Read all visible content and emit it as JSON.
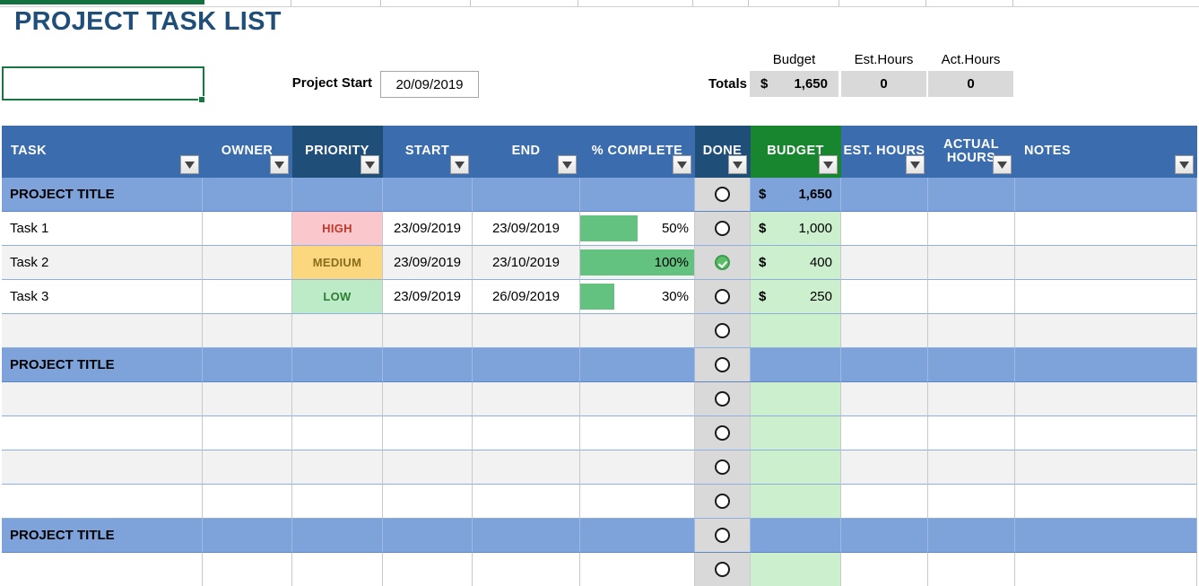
{
  "page": {
    "title": "PROJECT TASK LIST"
  },
  "project_start": {
    "label": "Project Start",
    "value": "20/09/2019"
  },
  "totals": {
    "label": "Totals",
    "headers": [
      "Budget",
      "Est.Hours",
      "Act.Hours"
    ],
    "budget_currency": "$",
    "budget_value": "1,650",
    "est_hours": "0",
    "act_hours": "0"
  },
  "table": {
    "columns": [
      {
        "label": "TASK",
        "align": "left",
        "filter": true,
        "style": "normal"
      },
      {
        "label": "OWNER",
        "align": "center",
        "filter": true,
        "style": "normal"
      },
      {
        "label": "PRIORITY",
        "align": "center",
        "filter": true,
        "style": "dark"
      },
      {
        "label": "START",
        "align": "center",
        "filter": true,
        "style": "normal"
      },
      {
        "label": "END",
        "align": "center",
        "filter": true,
        "style": "normal"
      },
      {
        "label": "% COMPLETE",
        "align": "center",
        "filter": true,
        "style": "normal"
      },
      {
        "label": "DONE",
        "align": "center",
        "filter": true,
        "style": "dark"
      },
      {
        "label": "BUDGET",
        "align": "center",
        "filter": true,
        "style": "green"
      },
      {
        "label": "EST. HOURS",
        "align": "center",
        "filter": true,
        "style": "normal"
      },
      {
        "label": "ACTUAL HOURS",
        "align": "center",
        "filter": true,
        "style": "normal"
      },
      {
        "label": "NOTES",
        "align": "left",
        "filter": true,
        "style": "normal"
      }
    ],
    "rows": [
      {
        "type": "section",
        "task": "PROJECT TITLE",
        "owner": "",
        "priority": "",
        "start": "",
        "end": "",
        "percent": null,
        "percent_label": "",
        "done": false,
        "budget_currency": "$",
        "budget": "1,650",
        "est_hours": "",
        "actual_hours": "",
        "notes": ""
      },
      {
        "type": "task",
        "task": "Task 1",
        "owner": "",
        "priority": "HIGH",
        "start": "23/09/2019",
        "end": "23/09/2019",
        "percent": 50,
        "percent_label": "50%",
        "done": false,
        "budget_currency": "$",
        "budget": "1,000",
        "est_hours": "",
        "actual_hours": "",
        "notes": ""
      },
      {
        "type": "task",
        "task": "Task 2",
        "owner": "",
        "priority": "MEDIUM",
        "start": "23/09/2019",
        "end": "23/10/2019",
        "percent": 100,
        "percent_label": "100%",
        "done": true,
        "budget_currency": "$",
        "budget": "400",
        "est_hours": "",
        "actual_hours": "",
        "notes": ""
      },
      {
        "type": "task",
        "task": "Task 3",
        "owner": "",
        "priority": "LOW",
        "start": "23/09/2019",
        "end": "26/09/2019",
        "percent": 30,
        "percent_label": "30%",
        "done": false,
        "budget_currency": "$",
        "budget": "250",
        "est_hours": "",
        "actual_hours": "",
        "notes": ""
      },
      {
        "type": "empty",
        "task": "",
        "owner": "",
        "priority": "",
        "start": "",
        "end": "",
        "percent": null,
        "percent_label": "",
        "done": false,
        "budget_currency": "",
        "budget": "",
        "est_hours": "",
        "actual_hours": "",
        "notes": ""
      },
      {
        "type": "section",
        "task": "PROJECT TITLE",
        "owner": "",
        "priority": "",
        "start": "",
        "end": "",
        "percent": null,
        "percent_label": "",
        "done": false,
        "budget_currency": "",
        "budget": "",
        "est_hours": "",
        "actual_hours": "",
        "notes": ""
      },
      {
        "type": "empty",
        "task": "",
        "owner": "",
        "priority": "",
        "start": "",
        "end": "",
        "percent": null,
        "percent_label": "",
        "done": false,
        "budget_currency": "",
        "budget": "",
        "est_hours": "",
        "actual_hours": "",
        "notes": ""
      },
      {
        "type": "empty",
        "task": "",
        "owner": "",
        "priority": "",
        "start": "",
        "end": "",
        "percent": null,
        "percent_label": "",
        "done": false,
        "budget_currency": "",
        "budget": "",
        "est_hours": "",
        "actual_hours": "",
        "notes": ""
      },
      {
        "type": "empty",
        "task": "",
        "owner": "",
        "priority": "",
        "start": "",
        "end": "",
        "percent": null,
        "percent_label": "",
        "done": false,
        "budget_currency": "",
        "budget": "",
        "est_hours": "",
        "actual_hours": "",
        "notes": ""
      },
      {
        "type": "empty",
        "task": "",
        "owner": "",
        "priority": "",
        "start": "",
        "end": "",
        "percent": null,
        "percent_label": "",
        "done": false,
        "budget_currency": "",
        "budget": "",
        "est_hours": "",
        "actual_hours": "",
        "notes": ""
      },
      {
        "type": "section",
        "task": "PROJECT TITLE",
        "owner": "",
        "priority": "",
        "start": "",
        "end": "",
        "percent": null,
        "percent_label": "",
        "done": false,
        "budget_currency": "",
        "budget": "",
        "est_hours": "",
        "actual_hours": "",
        "notes": ""
      },
      {
        "type": "empty",
        "task": "",
        "owner": "",
        "priority": "",
        "start": "",
        "end": "",
        "percent": null,
        "percent_label": "",
        "done": false,
        "budget_currency": "",
        "budget": "",
        "est_hours": "",
        "actual_hours": "",
        "notes": ""
      }
    ]
  },
  "colors": {
    "title": "#1F4E79",
    "header_blue": "#3B6DAE",
    "header_dark": "#1F4E79",
    "header_green": "#17862F",
    "section_row": "#7EA3DA",
    "bar_green": "#63C280",
    "priority_high_bg": "#FAC7CD",
    "priority_medium_bg": "#FBD77F",
    "priority_low_bg": "#BDEBC8",
    "budget_empty": "#CCEFCE",
    "done_col": "#D9D9D9",
    "selection": "#1a7544"
  }
}
